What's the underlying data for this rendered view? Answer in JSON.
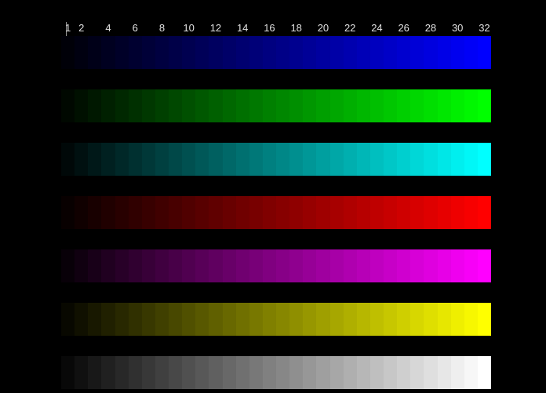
{
  "scale": {
    "labels": [
      1,
      2,
      4,
      6,
      8,
      10,
      12,
      14,
      16,
      18,
      20,
      22,
      24,
      26,
      28,
      30,
      32
    ]
  },
  "steps": 32,
  "ramps": [
    {
      "name": "blue",
      "rgb": [
        0,
        0,
        255
      ]
    },
    {
      "name": "green",
      "rgb": [
        0,
        255,
        0
      ]
    },
    {
      "name": "cyan",
      "rgb": [
        0,
        255,
        255
      ]
    },
    {
      "name": "red",
      "rgb": [
        255,
        0,
        0
      ]
    },
    {
      "name": "magenta",
      "rgb": [
        255,
        0,
        255
      ]
    },
    {
      "name": "yellow",
      "rgb": [
        255,
        255,
        0
      ]
    },
    {
      "name": "white",
      "rgb": [
        255,
        255,
        255
      ]
    }
  ]
}
